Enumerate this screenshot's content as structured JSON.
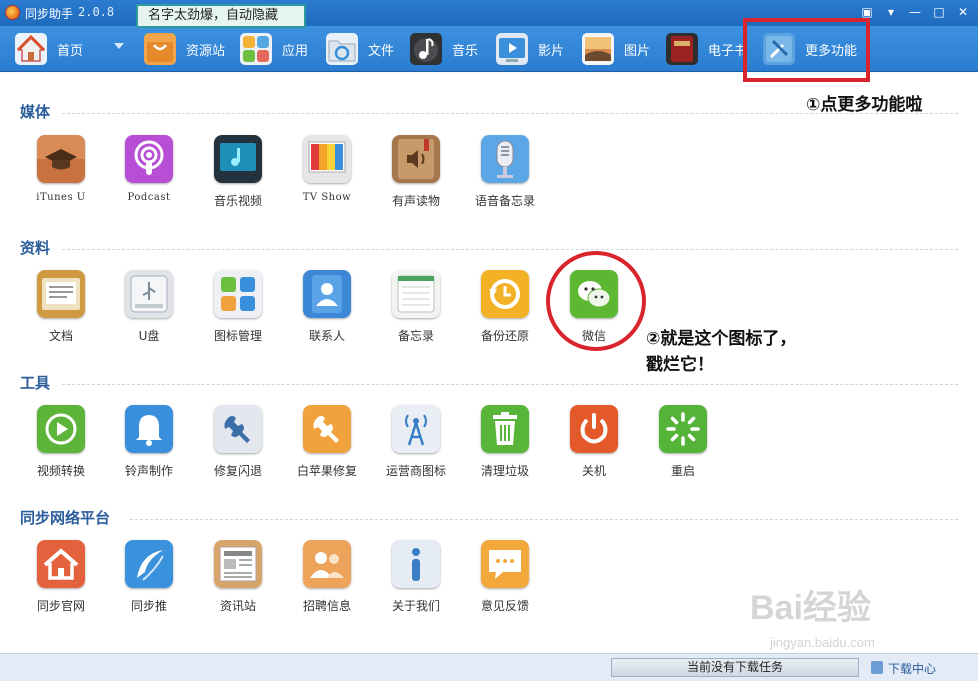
{
  "app": {
    "title": "同步助手",
    "version": "2.0.8",
    "tooltip": "名字太劲爆，自动隐藏",
    "window_controls": [
      "▣",
      "▾",
      "—",
      "□",
      "✕"
    ]
  },
  "toolbar": {
    "items": [
      {
        "label": "首页",
        "icon": "home-icon"
      },
      {
        "label": "资源站",
        "icon": "shopping-bag-icon"
      },
      {
        "label": "应用",
        "icon": "apps-icon"
      },
      {
        "label": "文件",
        "icon": "folder-icon"
      },
      {
        "label": "音乐",
        "icon": "music-icon"
      },
      {
        "label": "影片",
        "icon": "video-icon"
      },
      {
        "label": "图片",
        "icon": "photo-icon"
      },
      {
        "label": "电子书",
        "icon": "book-icon"
      },
      {
        "label": "更多功能",
        "icon": "tools-icon"
      }
    ]
  },
  "sections": [
    {
      "title": "媒体",
      "items": [
        {
          "label": "iTunes U",
          "icon": "itunes-u-icon",
          "color": "#c9723f"
        },
        {
          "label": "Podcast",
          "icon": "podcast-icon",
          "color": "#b64fd6"
        },
        {
          "label": "音乐视频",
          "icon": "music-video-icon",
          "color": "#24323d"
        },
        {
          "label": "TV Show",
          "icon": "tv-show-icon",
          "color": "#e6e6e6"
        },
        {
          "label": "有声读物",
          "icon": "audiobook-icon",
          "color": "#a4774c"
        },
        {
          "label": "语音备忘录",
          "icon": "microphone-icon",
          "color": "#5ba7e6"
        }
      ]
    },
    {
      "title": "资料",
      "items": [
        {
          "label": "文档",
          "icon": "document-icon",
          "color": "#d09a43"
        },
        {
          "label": "U盘",
          "icon": "usb-drive-icon",
          "color": "#e0e4e8"
        },
        {
          "label": "图标管理",
          "icon": "icon-manager-icon",
          "color": "#eef0f3"
        },
        {
          "label": "联系人",
          "icon": "contacts-icon",
          "color": "#3c88d6"
        },
        {
          "label": "备忘录",
          "icon": "notes-icon",
          "color": "#f1f4f0"
        },
        {
          "label": "备份还原",
          "icon": "backup-restore-icon",
          "color": "#f3b225"
        },
        {
          "label": "微信",
          "icon": "wechat-icon",
          "color": "#5cb832"
        }
      ]
    },
    {
      "title": "工具",
      "items": [
        {
          "label": "视频转换",
          "icon": "video-convert-icon",
          "color": "#5cb53a"
        },
        {
          "label": "铃声制作",
          "icon": "bell-icon",
          "color": "#3a8fdc"
        },
        {
          "label": "修复闪退",
          "icon": "wrench-icon",
          "color": "#e3e8ee"
        },
        {
          "label": "白苹果修复",
          "icon": "wrench-orange-icon",
          "color": "#f0a23c"
        },
        {
          "label": "运营商图标",
          "icon": "signal-tower-icon",
          "color": "#e8eef4"
        },
        {
          "label": "清理垃圾",
          "icon": "trash-icon",
          "color": "#59b43a"
        },
        {
          "label": "关机",
          "icon": "power-icon",
          "color": "#e4592a"
        },
        {
          "label": "重启",
          "icon": "restart-icon",
          "color": "#56b33a"
        }
      ]
    },
    {
      "title": "同步网络平台",
      "items": [
        {
          "label": "同步官网",
          "icon": "home-site-icon",
          "color": "#e4613d"
        },
        {
          "label": "同步推",
          "icon": "sync-push-icon",
          "color": "#3a92dc"
        },
        {
          "label": "资讯站",
          "icon": "news-icon",
          "color": "#d6a668"
        },
        {
          "label": "招聘信息",
          "icon": "recruit-icon",
          "color": "#eda35a"
        },
        {
          "label": "关于我们",
          "icon": "info-icon",
          "color": "#e6ecf3"
        },
        {
          "label": "意见反馈",
          "icon": "feedback-icon",
          "color": "#f2a83a"
        }
      ]
    }
  ],
  "annotations": {
    "step1": "①点更多功能啦",
    "step2_line1": "②就是这个图标了，",
    "step2_line2": "戳烂它！"
  },
  "statusbar": {
    "task_status": "当前没有下载任务",
    "download_center": "下载中心"
  },
  "watermark": {
    "brand": "Bai经验",
    "url": "jingyan.baidu.com"
  }
}
